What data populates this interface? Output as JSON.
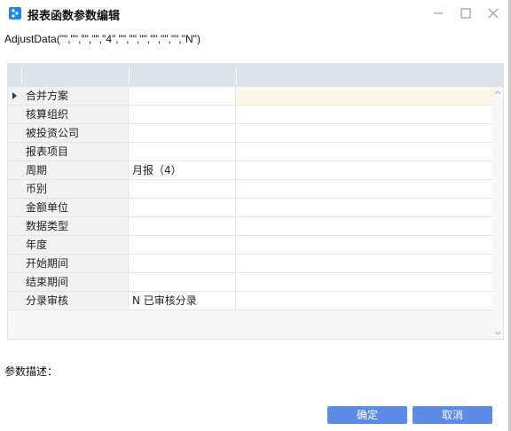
{
  "window": {
    "title": "报表函数参数编辑"
  },
  "formula": "AdjustData(\"\",\"\",\"\",\"\",\"4\",\"\",\"\",\"\",\"\",\"\",\"\",\"N\")",
  "grid": {
    "rows": [
      {
        "name": "合并方案",
        "value": ""
      },
      {
        "name": "核算组织",
        "value": ""
      },
      {
        "name": "被投资公司",
        "value": ""
      },
      {
        "name": "报表项目",
        "value": ""
      },
      {
        "name": "周期",
        "value": "月报（4）"
      },
      {
        "name": "币别",
        "value": ""
      },
      {
        "name": "金额单位",
        "value": ""
      },
      {
        "name": "数据类型",
        "value": ""
      },
      {
        "name": "年度",
        "value": ""
      },
      {
        "name": "开始期间",
        "value": ""
      },
      {
        "name": "结束期间",
        "value": ""
      },
      {
        "name": "分录审核",
        "value": "N  已审核分录"
      }
    ]
  },
  "description_label": "参数描述：",
  "buttons": {
    "ok": "确定",
    "cancel": "取消"
  }
}
